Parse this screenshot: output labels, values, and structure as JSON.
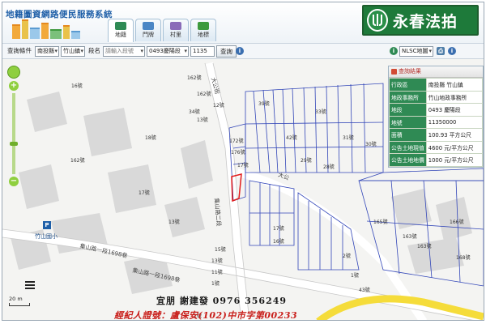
{
  "header": {
    "site_title": "地籍圖資網路便民服務系統",
    "tabs": [
      {
        "label": "地籍",
        "icon": "map-icon",
        "color": "#2f8a54"
      },
      {
        "label": "門牌",
        "icon": "house-icon",
        "color": "#4a86c5"
      },
      {
        "label": "村里",
        "icon": "village-icon",
        "color": "#8a6bb8"
      },
      {
        "label": "地標",
        "icon": "landmark-icon",
        "color": "#3d9a3d"
      }
    ],
    "brand_text": "永春法拍",
    "brand_color": "#1e7a3a"
  },
  "toolbar": {
    "query_label": "查詢條件",
    "county": "南投縣",
    "town": "竹山鎮",
    "section_label": "段名",
    "section_placeholder": "請輸入段號",
    "section_value": "0493慶陽段",
    "lot_number": "1135",
    "query_button": "查詢",
    "basemap": "NLSC地圖"
  },
  "results": {
    "title": "查詢結果",
    "rows": [
      {
        "k": "行政區",
        "v": "南投縣 竹山鎮"
      },
      {
        "k": "地政事務所",
        "v": "竹山地政事務所"
      },
      {
        "k": "地段",
        "v": "0493 慶陽段"
      },
      {
        "k": "地號",
        "v": "11350000"
      },
      {
        "k": "面積",
        "v": "100.93 平方公尺"
      },
      {
        "k": "公告土地現值",
        "v": "4600 元/平方公尺"
      },
      {
        "k": "公告土地地價",
        "v": "1000 元/平方公尺"
      }
    ]
  },
  "map": {
    "road_labels": [
      "集山路一段1698巷",
      "集山路一段1698巷",
      "大公街",
      "集山路二段",
      "大公"
    ],
    "place_label": "竹山國小",
    "lots": [
      "16號",
      "16號",
      "162號",
      "162號",
      "34號",
      "13號",
      "12號",
      "18號",
      "172號",
      "176號",
      "162號",
      "17號",
      "17號",
      "13號",
      "15號",
      "13號",
      "11號",
      "1號",
      "1號",
      "17號",
      "16號",
      "1號",
      "165號",
      "163號",
      "163號",
      "166號",
      "168號",
      "164號",
      "2號",
      "2號",
      "1號",
      "1號",
      "43號",
      "39號",
      "42號",
      "33號",
      "31號",
      "30號",
      "29號",
      "28號",
      "27號",
      "36號",
      "35號"
    ],
    "scale_label": "20 m"
  },
  "ad": {
    "line1": "宜朋  謝建發  0976 356249",
    "line2": "經紀人證號：盧保安(102)中市字第00233"
  }
}
